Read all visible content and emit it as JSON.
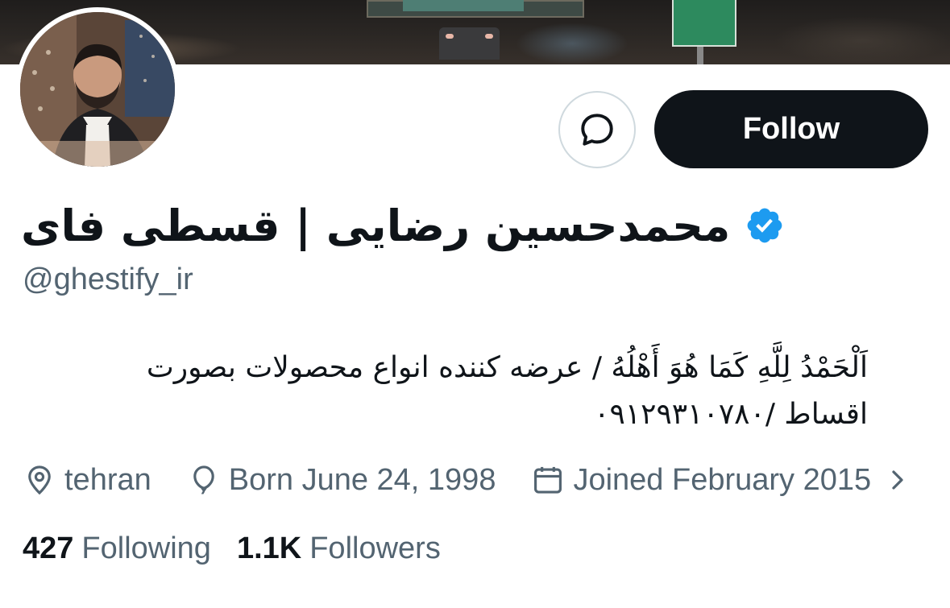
{
  "profile": {
    "display_name": "محمدحسین رضایی | قسطی فای",
    "handle": "@ghestify_ir",
    "verified": true,
    "bio": {
      "line1": "اَلْحَمْدُ لِلَّهِ کَمَا هُوَ أَهْلُهُ / عرضه کننده انواع محصولات بصورت",
      "line2": "اقساط /۰۹۱۲۹۳۱۰۷۸۰"
    },
    "location": "tehran",
    "birthday": "Born June 24, 1998",
    "joined": "Joined February 2015",
    "following_count": "427",
    "following_label": "Following",
    "followers_count": "1.1K",
    "followers_label": "Followers"
  },
  "actions": {
    "follow_label": "Follow",
    "message_icon": "message-bubble-icon"
  },
  "icons": {
    "verified": "verified-badge-icon",
    "location": "location-pin-icon",
    "birthday": "balloon-icon",
    "joined": "calendar-icon",
    "more": "chevron-right-icon"
  },
  "colors": {
    "verified": "#1d9bf0",
    "text_primary": "#0f1419",
    "text_secondary": "#536471",
    "button_dark": "#0f1419",
    "border": "#cfd9de"
  }
}
